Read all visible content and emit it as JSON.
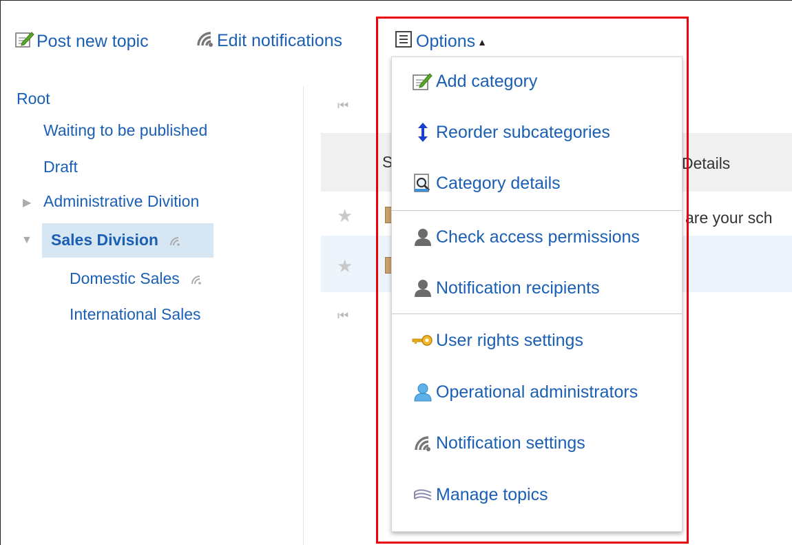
{
  "toolbar": {
    "post_new_topic": "Post new topic",
    "edit_notifications": "Edit notifications",
    "options": "Options",
    "options_caret": "▲"
  },
  "tree": {
    "root": "Root",
    "waiting": "Waiting to be published",
    "draft": "Draft",
    "administrative": "Administrative Divition",
    "sales": "Sales Division",
    "domestic": "Domestic Sales",
    "international": "International Sales"
  },
  "list": {
    "col_subject_partial": "S",
    "col_details": "Details",
    "row1_text_partial": "are your sch"
  },
  "options_menu": {
    "add_category": "Add category",
    "reorder_subcategories": "Reorder subcategories",
    "category_details": "Category details",
    "check_access_permissions": "Check access permissions",
    "notification_recipients": "Notification recipients",
    "user_rights_settings": "User rights settings",
    "operational_administrators": "Operational administrators",
    "notification_settings": "Notification settings",
    "manage_topics": "Manage topics"
  },
  "icons": {
    "post": "edit-note-icon",
    "notify": "rss-icon",
    "options": "list-menu-icon"
  },
  "colors": {
    "link": "#1a5fb4",
    "highlight_border": "#e8000b",
    "selected_bg": "#d6e6f3"
  }
}
